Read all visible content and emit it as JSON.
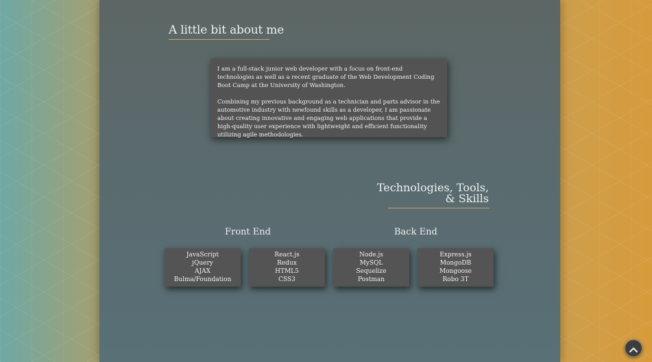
{
  "about": {
    "title": "A little bit about me",
    "paragraphs": [
      "I am a full-stack junior web developer with a focus on front-end technologies as well as a recent graduate of the Web Development Coding Boot Camp at the University of Washington.",
      "Combining my previous background as a technician and parts advisor in the automotive industry with newfound skills as a developer, I am passionate about creating innovative and engaging web applications that provide a high-quality user experience with lightweight and efficient functionality utilizing agile methodologies."
    ]
  },
  "skills": {
    "title_line1": "Technologies, Tools,",
    "title_line2": "& Skills",
    "front_end_heading": "Front End",
    "back_end_heading": "Back End",
    "boxes": [
      [
        "JavaScript",
        "jQuery",
        "AJAX",
        "Bulma/Foundation"
      ],
      [
        "React.js",
        "Redux",
        "HTML5",
        "CSS3"
      ],
      [
        "Node.js",
        "MySQL",
        "Sequelize",
        "Postman"
      ],
      [
        "Express.js",
        "MongoDB",
        "Mongoose",
        "Robo 3T"
      ]
    ]
  },
  "controls": {
    "scroll_top_icon": "chevron-up-icon"
  },
  "colors": {
    "accent_underline": "#c9a36a",
    "panel": "#5a6b6f",
    "card": "#535353"
  }
}
